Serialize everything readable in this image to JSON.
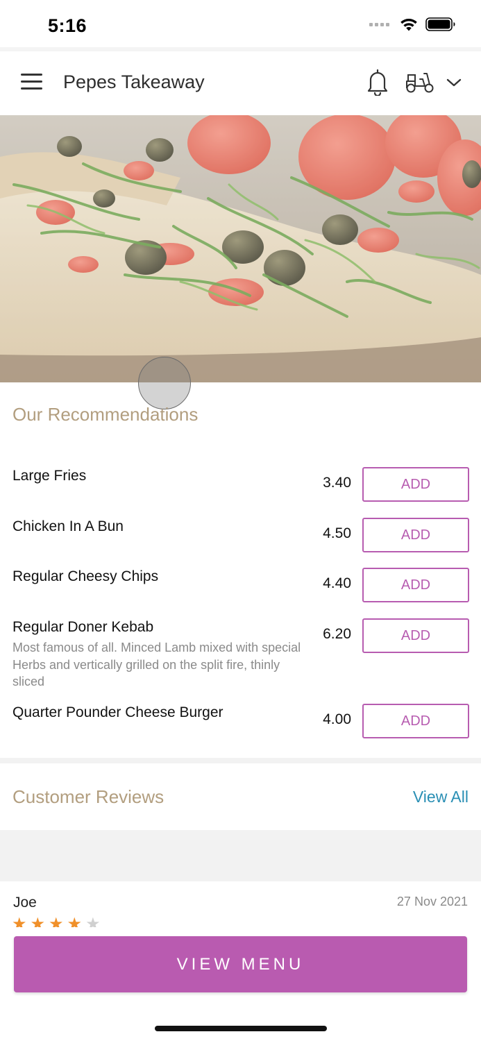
{
  "status_bar": {
    "time": "5:16",
    "icons": [
      "signal-icon",
      "wifi-icon",
      "battery-icon"
    ]
  },
  "header": {
    "title": "Pepes Takeaway",
    "icons": [
      "hamburger-menu-icon",
      "bell-icon",
      "scooter-icon",
      "chevron-down-icon"
    ]
  },
  "recommendations": {
    "heading": "Our Recommendations",
    "items": [
      {
        "name": "Large Fries",
        "price": "3.40",
        "button": "ADD"
      },
      {
        "name": "Chicken In A Bun",
        "price": "4.50",
        "button": "ADD"
      },
      {
        "name": "Regular Cheesy Chips",
        "price": "4.40",
        "button": "ADD"
      },
      {
        "name": "Regular Doner Kebab",
        "price": "6.20",
        "button": "ADD",
        "description": "Most famous of all. Minced Lamb mixed with special Herbs and vertically grilled on the split fire, thinly sliced"
      },
      {
        "name": "Quarter Pounder Cheese Burger",
        "price": "4.00",
        "button": "ADD"
      }
    ]
  },
  "reviews": {
    "heading": "Customer Reviews",
    "view_all": "View All",
    "items": [
      {
        "reviewer": "Joe",
        "date": "27 Nov 2021",
        "rating": 4,
        "max_rating": 5
      }
    ]
  },
  "cta": {
    "label": "VIEW MENU"
  },
  "colors": {
    "accent": "#b95bb0",
    "heading": "#b29e7f",
    "link": "#2a8fb4",
    "star_filled": "#f0902a",
    "star_empty": "#d0d0d0"
  }
}
